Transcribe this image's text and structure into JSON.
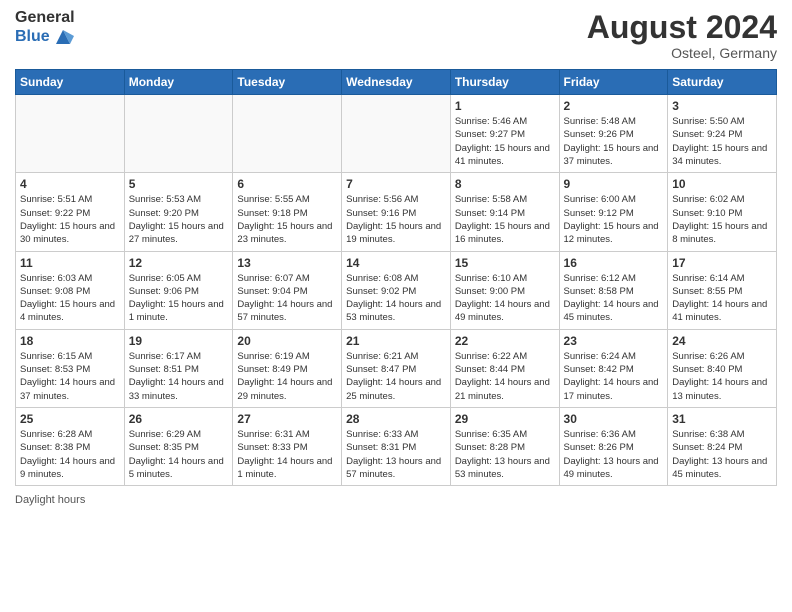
{
  "header": {
    "logo_general": "General",
    "logo_blue": "Blue",
    "month_year": "August 2024",
    "location": "Osteel, Germany"
  },
  "days_of_week": [
    "Sunday",
    "Monday",
    "Tuesday",
    "Wednesday",
    "Thursday",
    "Friday",
    "Saturday"
  ],
  "weeks": [
    [
      {
        "day": "",
        "info": ""
      },
      {
        "day": "",
        "info": ""
      },
      {
        "day": "",
        "info": ""
      },
      {
        "day": "",
        "info": ""
      },
      {
        "day": "1",
        "info": "Sunrise: 5:46 AM\nSunset: 9:27 PM\nDaylight: 15 hours\nand 41 minutes."
      },
      {
        "day": "2",
        "info": "Sunrise: 5:48 AM\nSunset: 9:26 PM\nDaylight: 15 hours\nand 37 minutes."
      },
      {
        "day": "3",
        "info": "Sunrise: 5:50 AM\nSunset: 9:24 PM\nDaylight: 15 hours\nand 34 minutes."
      }
    ],
    [
      {
        "day": "4",
        "info": "Sunrise: 5:51 AM\nSunset: 9:22 PM\nDaylight: 15 hours\nand 30 minutes."
      },
      {
        "day": "5",
        "info": "Sunrise: 5:53 AM\nSunset: 9:20 PM\nDaylight: 15 hours\nand 27 minutes."
      },
      {
        "day": "6",
        "info": "Sunrise: 5:55 AM\nSunset: 9:18 PM\nDaylight: 15 hours\nand 23 minutes."
      },
      {
        "day": "7",
        "info": "Sunrise: 5:56 AM\nSunset: 9:16 PM\nDaylight: 15 hours\nand 19 minutes."
      },
      {
        "day": "8",
        "info": "Sunrise: 5:58 AM\nSunset: 9:14 PM\nDaylight: 15 hours\nand 16 minutes."
      },
      {
        "day": "9",
        "info": "Sunrise: 6:00 AM\nSunset: 9:12 PM\nDaylight: 15 hours\nand 12 minutes."
      },
      {
        "day": "10",
        "info": "Sunrise: 6:02 AM\nSunset: 9:10 PM\nDaylight: 15 hours\nand 8 minutes."
      }
    ],
    [
      {
        "day": "11",
        "info": "Sunrise: 6:03 AM\nSunset: 9:08 PM\nDaylight: 15 hours\nand 4 minutes."
      },
      {
        "day": "12",
        "info": "Sunrise: 6:05 AM\nSunset: 9:06 PM\nDaylight: 15 hours\nand 1 minute."
      },
      {
        "day": "13",
        "info": "Sunrise: 6:07 AM\nSunset: 9:04 PM\nDaylight: 14 hours\nand 57 minutes."
      },
      {
        "day": "14",
        "info": "Sunrise: 6:08 AM\nSunset: 9:02 PM\nDaylight: 14 hours\nand 53 minutes."
      },
      {
        "day": "15",
        "info": "Sunrise: 6:10 AM\nSunset: 9:00 PM\nDaylight: 14 hours\nand 49 minutes."
      },
      {
        "day": "16",
        "info": "Sunrise: 6:12 AM\nSunset: 8:58 PM\nDaylight: 14 hours\nand 45 minutes."
      },
      {
        "day": "17",
        "info": "Sunrise: 6:14 AM\nSunset: 8:55 PM\nDaylight: 14 hours\nand 41 minutes."
      }
    ],
    [
      {
        "day": "18",
        "info": "Sunrise: 6:15 AM\nSunset: 8:53 PM\nDaylight: 14 hours\nand 37 minutes."
      },
      {
        "day": "19",
        "info": "Sunrise: 6:17 AM\nSunset: 8:51 PM\nDaylight: 14 hours\nand 33 minutes."
      },
      {
        "day": "20",
        "info": "Sunrise: 6:19 AM\nSunset: 8:49 PM\nDaylight: 14 hours\nand 29 minutes."
      },
      {
        "day": "21",
        "info": "Sunrise: 6:21 AM\nSunset: 8:47 PM\nDaylight: 14 hours\nand 25 minutes."
      },
      {
        "day": "22",
        "info": "Sunrise: 6:22 AM\nSunset: 8:44 PM\nDaylight: 14 hours\nand 21 minutes."
      },
      {
        "day": "23",
        "info": "Sunrise: 6:24 AM\nSunset: 8:42 PM\nDaylight: 14 hours\nand 17 minutes."
      },
      {
        "day": "24",
        "info": "Sunrise: 6:26 AM\nSunset: 8:40 PM\nDaylight: 14 hours\nand 13 minutes."
      }
    ],
    [
      {
        "day": "25",
        "info": "Sunrise: 6:28 AM\nSunset: 8:38 PM\nDaylight: 14 hours\nand 9 minutes."
      },
      {
        "day": "26",
        "info": "Sunrise: 6:29 AM\nSunset: 8:35 PM\nDaylight: 14 hours\nand 5 minutes."
      },
      {
        "day": "27",
        "info": "Sunrise: 6:31 AM\nSunset: 8:33 PM\nDaylight: 14 hours\nand 1 minute."
      },
      {
        "day": "28",
        "info": "Sunrise: 6:33 AM\nSunset: 8:31 PM\nDaylight: 13 hours\nand 57 minutes."
      },
      {
        "day": "29",
        "info": "Sunrise: 6:35 AM\nSunset: 8:28 PM\nDaylight: 13 hours\nand 53 minutes."
      },
      {
        "day": "30",
        "info": "Sunrise: 6:36 AM\nSunset: 8:26 PM\nDaylight: 13 hours\nand 49 minutes."
      },
      {
        "day": "31",
        "info": "Sunrise: 6:38 AM\nSunset: 8:24 PM\nDaylight: 13 hours\nand 45 minutes."
      }
    ]
  ],
  "footer": {
    "daylight_hours_label": "Daylight hours"
  }
}
